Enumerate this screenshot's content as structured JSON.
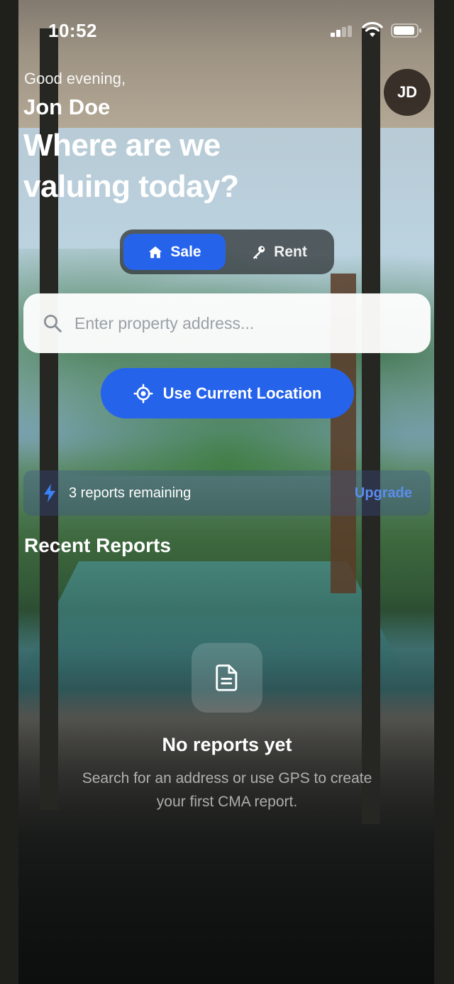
{
  "status_bar": {
    "time": "10:52"
  },
  "header": {
    "greeting": "Good evening,",
    "user_name": "Jon Doe",
    "headline": "Where are we valuing today?",
    "avatar_initials": "JD"
  },
  "mode_toggle": {
    "options": [
      {
        "label": "Sale",
        "icon": "home-icon",
        "selected": true
      },
      {
        "label": "Rent",
        "icon": "key-icon",
        "selected": false
      }
    ]
  },
  "search": {
    "placeholder": "Enter property address...",
    "value": ""
  },
  "location_button": {
    "label": "Use Current Location",
    "icon": "crosshair-icon"
  },
  "quota": {
    "text": "3 reports remaining",
    "action": "Upgrade",
    "icon": "lightning-icon"
  },
  "recent_reports": {
    "title": "Recent Reports",
    "empty_title": "No reports yet",
    "empty_description": "Search for an address or use GPS to create your first CMA report."
  },
  "colors": {
    "accent": "#2563eb",
    "upgrade_link": "#5b8def"
  }
}
